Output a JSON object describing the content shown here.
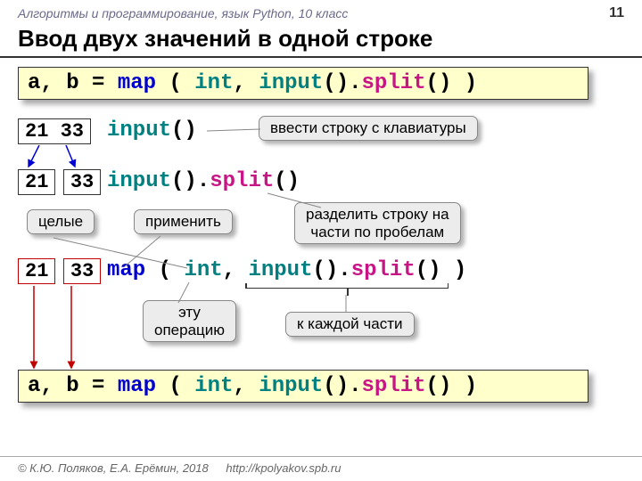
{
  "header": {
    "course": "Алгоритмы и программирование, язык Python, 10 класс",
    "page": "11"
  },
  "title": "Ввод двух значений в одной строке",
  "code": {
    "full_prefix": "a, b = ",
    "map": "map",
    "lp": " ( ",
    "int": "int",
    "comma": ", ",
    "input": "input",
    "parens": "()",
    "dot": ".",
    "split": "split",
    "rp": " )"
  },
  "vals": {
    "pair": "21 33",
    "a": "21",
    "b": "33"
  },
  "bubbles": {
    "enter_str": "ввести строку с клавиатуры",
    "int_label": "целые",
    "apply": "применить",
    "split_desc": "разделить строку на\nчасти по пробелам",
    "this_op": "эту\nоперацию",
    "each_part": "к каждой части"
  },
  "footer": {
    "copyright": "© К.Ю. Поляков, Е.А. Ерёмин, 2018",
    "url": "http://kpolyakov.spb.ru"
  }
}
